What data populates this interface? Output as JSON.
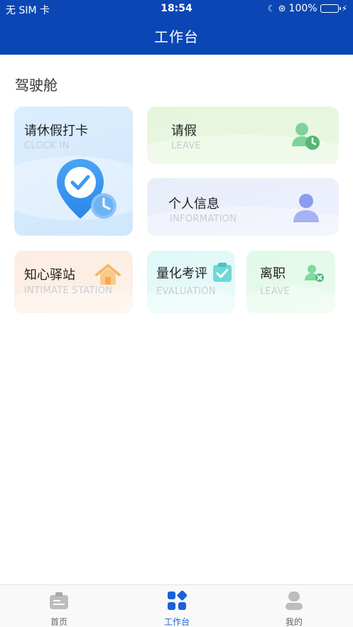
{
  "status_bar": {
    "carrier": "无 SIM 卡",
    "time": "18:54",
    "battery": "100%"
  },
  "header": {
    "title": "工作台"
  },
  "section": {
    "title": "驾驶舱"
  },
  "cards": {
    "clock_in": {
      "title": "请休假打卡",
      "subtitle": "CLOCK IN"
    },
    "leave": {
      "title": "请假",
      "subtitle": "LEAVE"
    },
    "information": {
      "title": "个人信息",
      "subtitle": "INFORMATION"
    },
    "station": {
      "title": "知心驿站",
      "subtitle": "INTIMATE STATION"
    },
    "evaluation": {
      "title": "量化考评",
      "subtitle": "EVALUATION"
    },
    "resign": {
      "title": "离职",
      "subtitle": "LEAVE"
    }
  },
  "tabbar": {
    "home": "首页",
    "workbench": "工作台",
    "mine": "我的"
  },
  "colors": {
    "header": "#0a47b5",
    "active_tab": "#1a62d8"
  }
}
